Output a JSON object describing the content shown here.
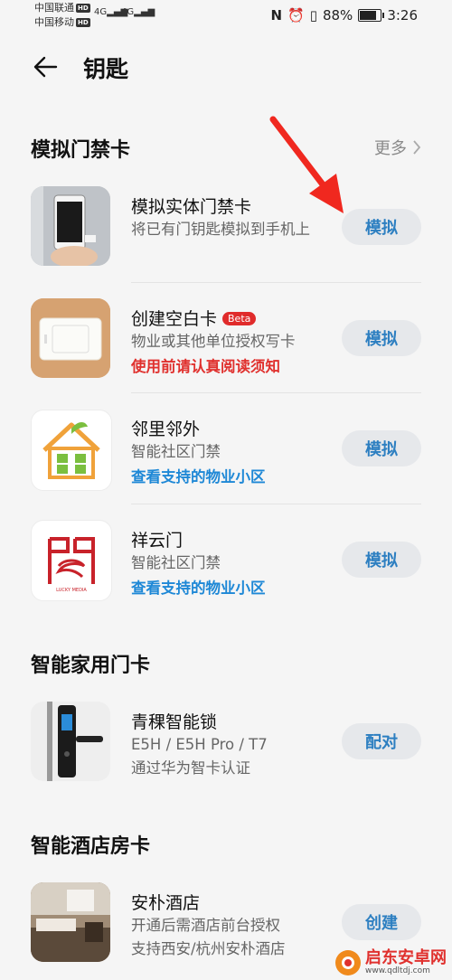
{
  "status": {
    "carrier1": "中国联通",
    "carrier2": "中国移动",
    "hd": "HD",
    "net": "4G",
    "battery": "88%",
    "time": "3:26"
  },
  "header": {
    "title": "钥匙"
  },
  "sections": {
    "door": {
      "title": "模拟门禁卡",
      "more": "更多"
    },
    "home": {
      "title": "智能家用门卡"
    },
    "hotel": {
      "title": "智能酒店房卡"
    }
  },
  "items": [
    {
      "name": "模拟实体门禁卡",
      "desc": "将已有门钥匙模拟到手机上",
      "button": "模拟"
    },
    {
      "name": "创建空白卡",
      "badge": "Beta",
      "desc": "物业或其他单位授权写卡",
      "link": "使用前请认真阅读须知",
      "link_color": "#e0312e",
      "button": "模拟"
    },
    {
      "name": "邻里邻外",
      "desc": "智能社区门禁",
      "link": "查看支持的物业小区",
      "link_color": "#1e88d6",
      "button": "模拟"
    },
    {
      "name": "祥云门",
      "desc": "智能社区门禁",
      "link": "查看支持的物业小区",
      "link_color": "#1e88d6",
      "button": "模拟",
      "logo_text": "LUCKY MEDIA"
    },
    {
      "name": "青稞智能锁",
      "desc": "E5H / E5H Pro / T7",
      "desc2": "通过华为智卡认证",
      "button": "配对"
    },
    {
      "name": "安朴酒店",
      "desc": "开通后需酒店前台授权",
      "desc2": "支持西安/杭州安朴酒店",
      "button": "创建"
    }
  ],
  "watermark": {
    "text": "启东安卓网",
    "url": "www.qdltdj.com"
  }
}
